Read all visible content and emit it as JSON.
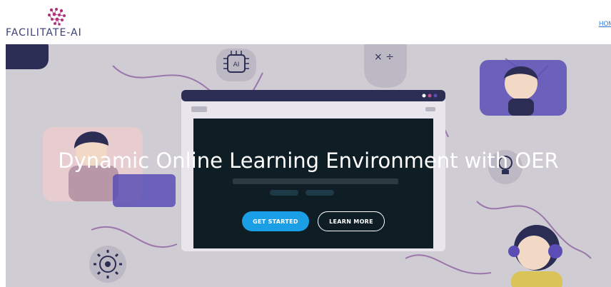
{
  "header": {
    "logo_text": "FACILITATE-AI",
    "nav": {
      "home_label": "HOM"
    }
  },
  "hero": {
    "title": "Dynamic Online Learning Environment with OER",
    "primary_button": "GET STARTED",
    "secondary_button": "LEARN MORE",
    "illustration": {
      "icons": [
        "ai-chip-icon",
        "math-symbols-icon",
        "gear-icon",
        "lightbulb-icon"
      ],
      "chip_label": "AI",
      "math_symbols": "× ÷"
    }
  },
  "colors": {
    "accent": "#1a9ee6",
    "logo_text": "#3a3f73",
    "hero_overlay": "#cfccd3",
    "nav_link": "#2a7bd6"
  }
}
